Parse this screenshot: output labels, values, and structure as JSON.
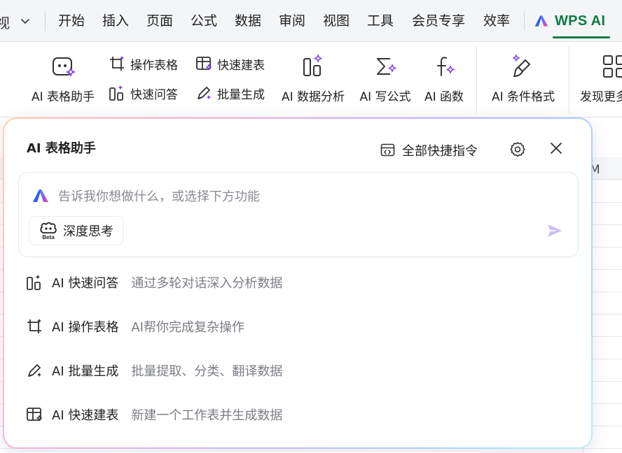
{
  "menubar": {
    "fragment": "视",
    "items": [
      "开始",
      "插入",
      "页面",
      "公式",
      "数据",
      "审阅",
      "视图",
      "工具",
      "会员专享",
      "效率"
    ],
    "wps_ai": "WPS AI",
    "accent_color": "#0f7a45"
  },
  "ribbon": {
    "ai_table_assistant": "AI 表格助手",
    "operate_table": "操作表格",
    "quick_qa": "快速问答",
    "quick_build": "快速建表",
    "batch_generate": "批量生成",
    "data_analysis": "AI 数据分析",
    "write_formula": "AI 写公式",
    "function": "AI 函数",
    "conditional_format": "AI 条件格式",
    "discover_more": "发现更多"
  },
  "sheet": {
    "column_label": "M"
  },
  "panel": {
    "title": "AI 表格助手",
    "all_shortcuts": "全部快捷指令",
    "input_placeholder": "告诉我你想做什么，或选择下方功能",
    "deep_think": "深度思考",
    "beta_badge": "Beta",
    "features": [
      {
        "name": "AI 快速问答",
        "desc": "通过多轮对话深入分析数据",
        "icon": "qa-icon"
      },
      {
        "name": "AI 操作表格",
        "desc": "AI帮你完成复杂操作",
        "icon": "crop-icon"
      },
      {
        "name": "AI 批量生成",
        "desc": "批量提取、分类、翻译数据",
        "icon": "pen-sparkle-icon"
      },
      {
        "name": "AI 快速建表",
        "desc": "新建一个工作表并生成数据",
        "icon": "table-sparkle-icon"
      }
    ],
    "accent_purple": "#7c3aed"
  }
}
